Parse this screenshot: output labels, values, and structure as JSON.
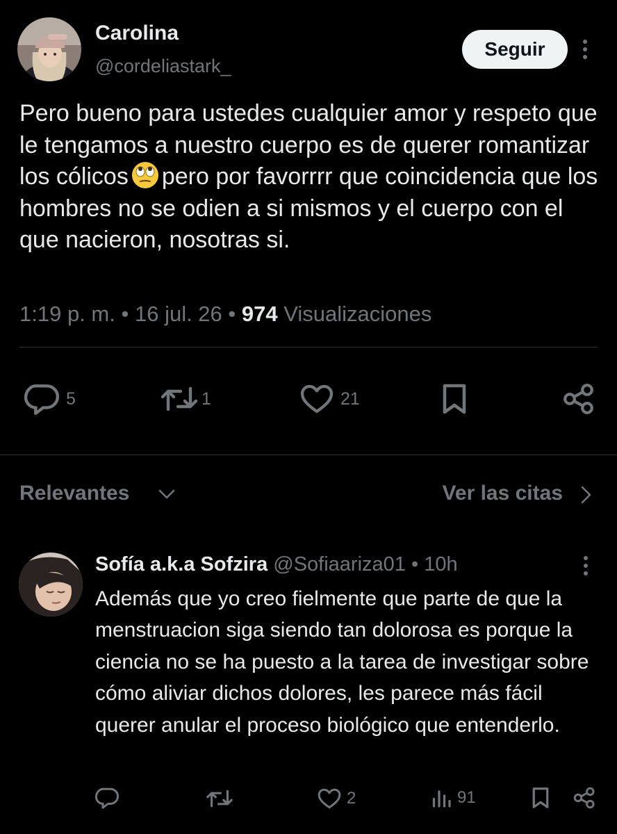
{
  "post": {
    "author_name": "Carolina",
    "author_handle": "@cordeliastark_",
    "follow_label": "Seguir",
    "text_part1": "Pero bueno para ustedes cualquier amor y respeto que le tengamos a nuestro cuerpo es de querer romantizar los cólicos",
    "emoji": "face-with-rolling-eyes-icon",
    "text_part2": "pero por favorrrr que coincidencia que los hombres no se odien a si mismos y el cuerpo con el que nacieron, nosotras si.",
    "time": "1:19 p. m.",
    "date": "16 jul. 26",
    "views_count": "974",
    "views_label": "Visualizaciones",
    "separator": "•",
    "replies": "5",
    "reposts": "1",
    "likes": "21"
  },
  "filter": {
    "label": "Relevantes",
    "quotes_link": "Ver las citas"
  },
  "reply": {
    "author_name": "Sofía a.k.a Sofzira",
    "author_handle": "@Sofiaariza01",
    "separator": "•",
    "time": "10h",
    "text": "Además que yo creo fielmente que parte de que la menstruacion siga siendo tan dolorosa es porque la ciencia no se ha puesto a la tarea de investigar sobre cómo aliviar dichos dolores, les parece más fácil querer anular el proceso biológico que entenderlo.",
    "replies": "",
    "reposts": "",
    "likes": "2",
    "views": "91"
  },
  "colors": {
    "background": "#000000",
    "text_primary": "#e7e9ea",
    "text_secondary": "#71767b",
    "divider": "#2f3336",
    "button_bg": "#eff3f4"
  }
}
